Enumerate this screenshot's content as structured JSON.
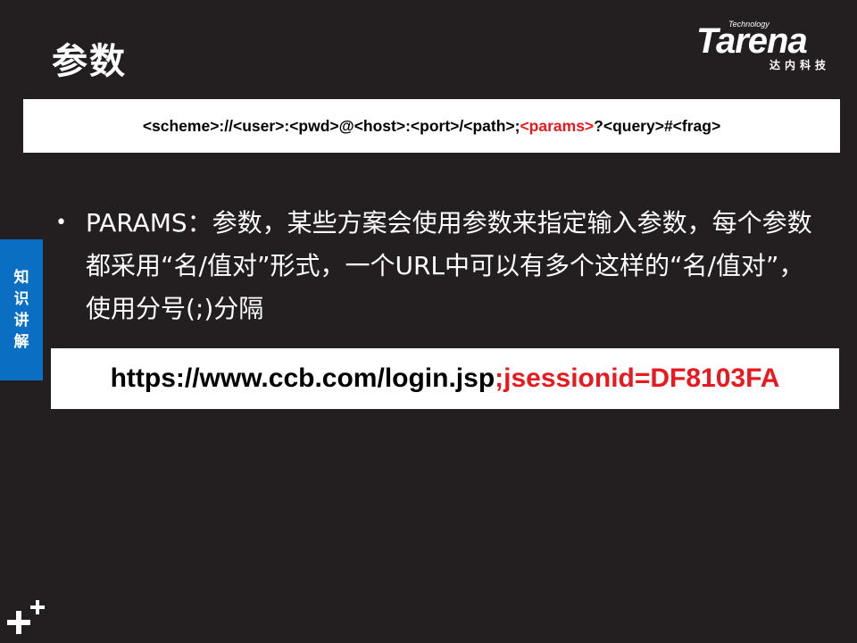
{
  "slide": {
    "title": "参数",
    "logo": {
      "tagline": "Technology",
      "wordmark": "Tarena",
      "chinese": "达内科技"
    },
    "uri_template": {
      "before": "<scheme>://<user>:<pwd>@<host>:<port>/<path>;",
      "highlight": "<params>",
      "after": "?<query>#<frag>"
    },
    "side_tab": "知识讲解",
    "bullet": {
      "marker": "•",
      "text": "PARAMS：参数，某些方案会使用参数来指定输入参数，每个参数都采用“名/值对”形式，一个URL中可以有多个这样的“名/值对”，使用分号(;)分隔"
    },
    "example_url": {
      "base": "https://www.ccb.com/login.jsp",
      "highlight": ";jsessionid=DF8103FA"
    },
    "colors": {
      "background": "#231f20",
      "accent_red": "#e8191f",
      "tab_blue": "#0a6fc2"
    }
  }
}
